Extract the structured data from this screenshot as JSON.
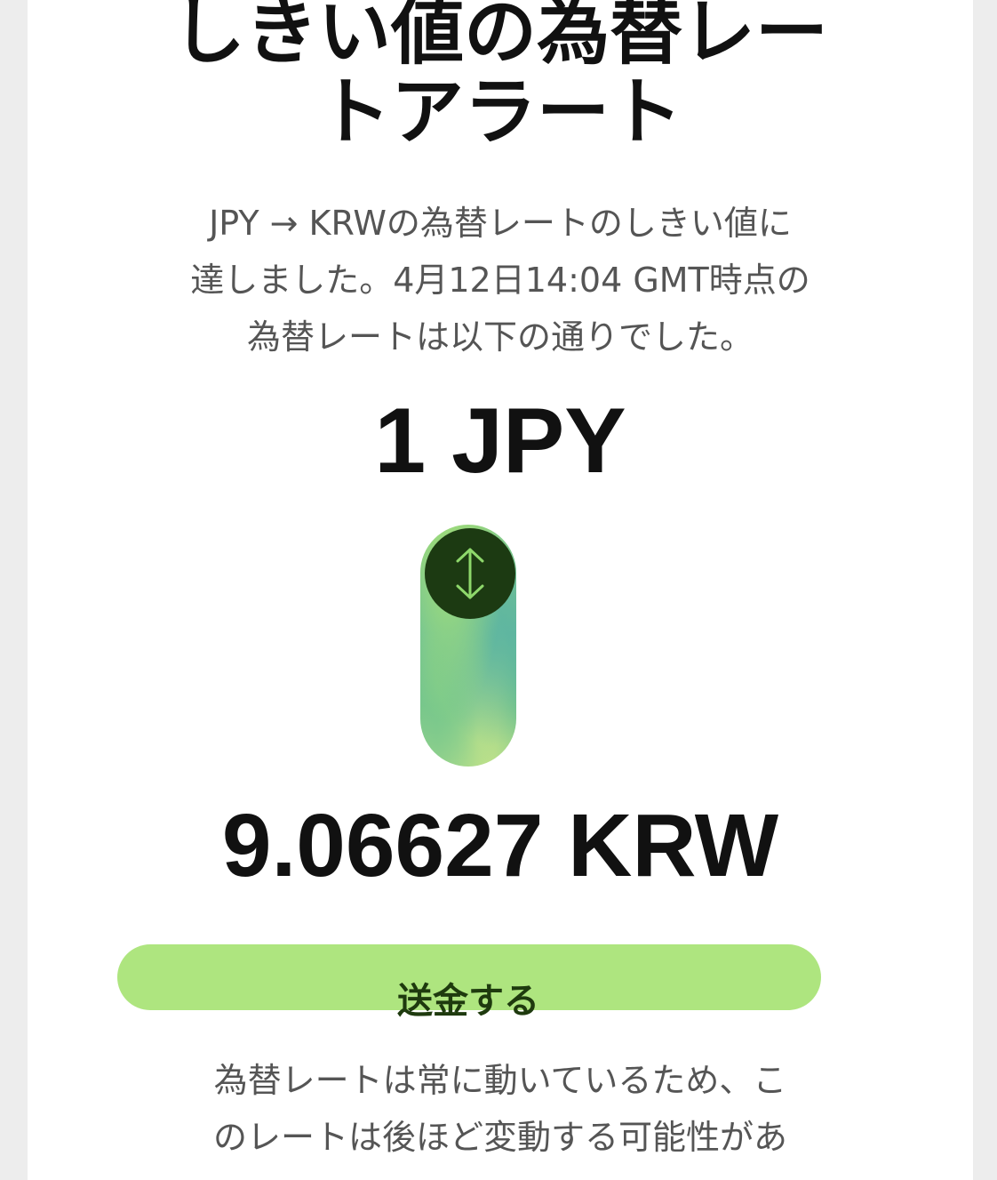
{
  "alert": {
    "title_lines": [
      "しきい値の為替レー",
      "トアラート"
    ],
    "intro_lines": [
      "JPY → KRWの為替レートのしきい値に",
      "達しました。4月12日14:04 GMT時点の",
      "為替レートは以下の通りでした。"
    ]
  },
  "conversion": {
    "from_amount": "1 JPY",
    "to_amount": "9.06627 KRW",
    "swap_icon": "swap-vertical-arrows-icon"
  },
  "actions": {
    "send_label": "送金する"
  },
  "disclaimer": {
    "lines": [
      "為替レートは常に動いているため、こ",
      "のレートは後ほど変動する可能性があ"
    ]
  },
  "colors": {
    "accent_green": "#aee57f",
    "dark_green": "#1c3a12",
    "text_dark": "#111111",
    "text_muted": "#555555"
  }
}
